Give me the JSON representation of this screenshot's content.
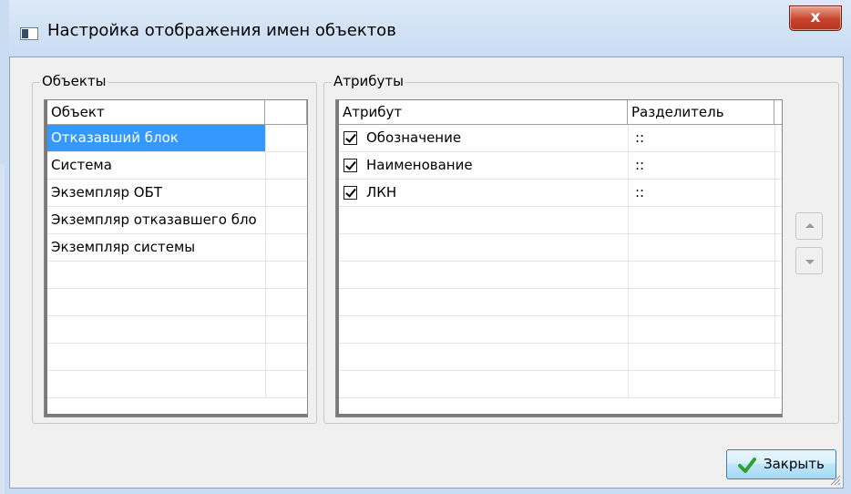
{
  "window": {
    "title": "Настройка отображения имен объектов",
    "close_glyph": "x"
  },
  "objects_group": {
    "label": "Объекты",
    "columns": [
      "Объект",
      ""
    ],
    "items": [
      {
        "label": "Отказавший блок",
        "selected": true
      },
      {
        "label": "Система",
        "selected": false
      },
      {
        "label": "Экземпляр ОБТ",
        "selected": false
      },
      {
        "label": "Экземпляр отказавшего бло",
        "selected": false
      },
      {
        "label": "Экземпляр системы",
        "selected": false
      }
    ]
  },
  "attributes_group": {
    "label": "Атрибуты",
    "columns": [
      "Атрибут",
      "Разделитель",
      ""
    ],
    "items": [
      {
        "label": "Обозначение",
        "separator": "::",
        "checked": true
      },
      {
        "label": "Наименование",
        "separator": "::",
        "checked": true
      },
      {
        "label": "ЛКН",
        "separator": "::",
        "checked": true
      }
    ]
  },
  "buttons": {
    "move_up_icon": "triangle-up-icon",
    "move_down_icon": "triangle-down-icon",
    "close_label": "Закрыть"
  },
  "colors": {
    "selection": "#3399ff",
    "title_bar": "#c9dcf2",
    "close_button": "#c7432b",
    "accent_check": "#2fa12f"
  }
}
